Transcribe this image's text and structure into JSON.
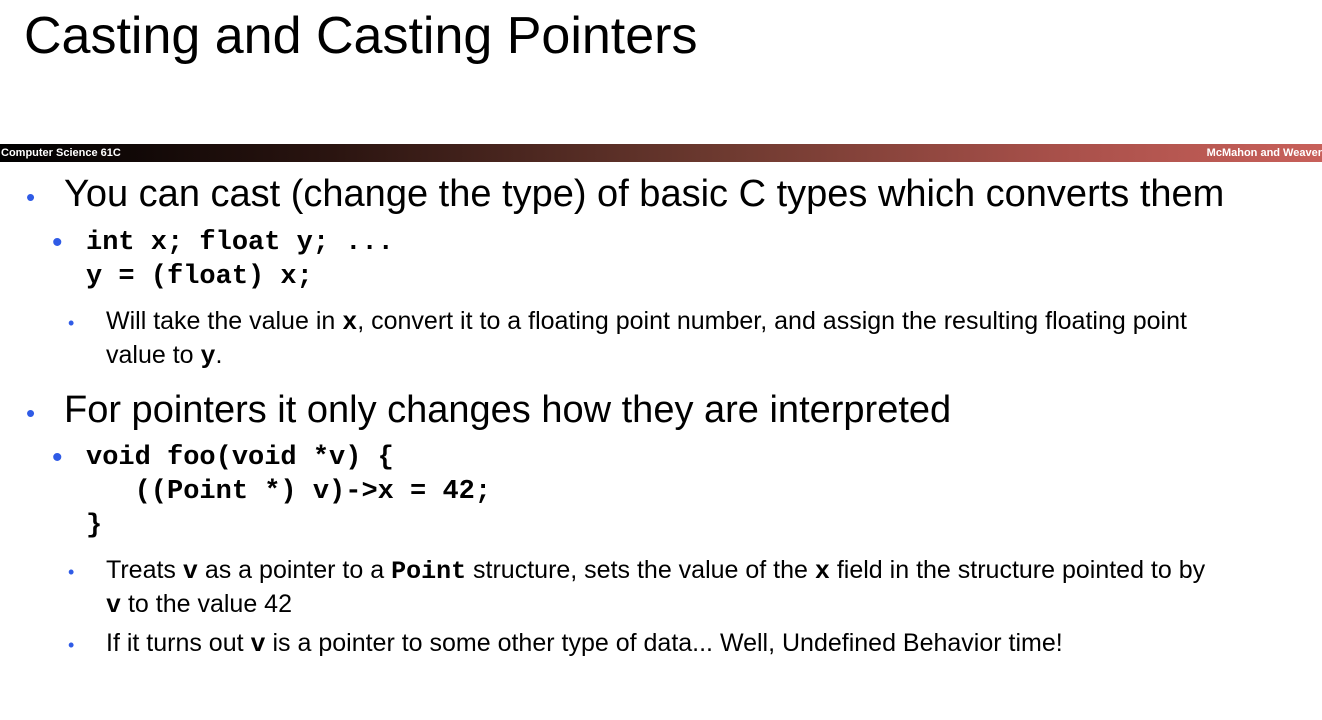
{
  "slide": {
    "title": "Casting and Casting Pointers",
    "course": "Computer Science 61C",
    "authors": "McMahon and Weaver",
    "bullet_glyph": "•"
  },
  "points": [
    {
      "text": "You can cast (change the type) of basic C types which converts them",
      "code": [
        "int x; float y; ...",
        "y = (float) x;"
      ],
      "notes": [
        {
          "parts": [
            "Will take the value in ",
            "x",
            ", convert it to a floating point number, and assign the resulting floating point"
          ],
          "line2": [
            "value to ",
            "y",
            "."
          ]
        }
      ]
    },
    {
      "text": "For pointers it only changes how they are interpreted",
      "code": [
        "void foo(void *v) {",
        "   ((Point *) v)->x = 42;",
        "}"
      ],
      "notes": [
        {
          "parts": [
            "Treats ",
            "v",
            " as a pointer to a ",
            "Point",
            " structure, sets the value of the ",
            "x",
            " field in the structure pointed to by"
          ],
          "line2": [
            "v",
            " to the value 42"
          ]
        },
        {
          "parts": [
            "If it turns out ",
            "v",
            " is a pointer to some other type of data...  Well, Undefined Behavior time!"
          ]
        }
      ]
    }
  ]
}
